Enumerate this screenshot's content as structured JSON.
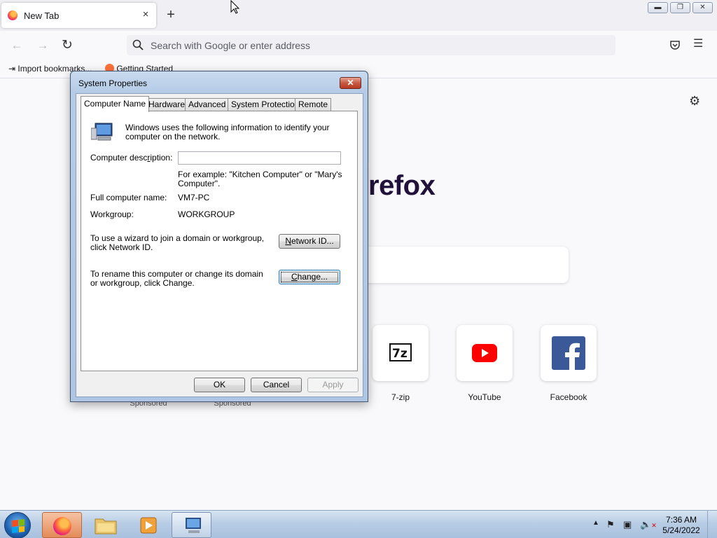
{
  "browser": {
    "tab_title": "New Tab",
    "tab_close": "×",
    "new_tab": "+",
    "url_placeholder": "Search with Google or enter address",
    "bookmarks": [
      {
        "label": "Import bookmarks..."
      },
      {
        "label": "Getting Started"
      }
    ]
  },
  "newtab": {
    "brand_text": "refox",
    "sponsored": [
      "Sponsored",
      "Sponsored"
    ],
    "shortcuts": [
      {
        "label": "7-zip",
        "icon": "7zip-icon"
      },
      {
        "label": "YouTube",
        "icon": "youtube-icon"
      },
      {
        "label": "Facebook",
        "icon": "facebook-icon"
      }
    ]
  },
  "dialog": {
    "title": "System Properties",
    "close": "✕",
    "tabs": [
      "Computer Name",
      "Hardware",
      "Advanced",
      "System Protection",
      "Remote"
    ],
    "intro": "Windows uses the following information to identify your computer on the network.",
    "description_label": "Computer description:",
    "description_value": "",
    "example": "For example: \"Kitchen Computer\" or \"Mary's Computer\".",
    "full_name_label": "Full computer name:",
    "full_name_value": "VM7-PC",
    "workgroup_label": "Workgroup:",
    "workgroup_value": "WORKGROUP",
    "network_text": "To use a wizard to join a domain or workgroup, click Network ID.",
    "network_button": "Network ID...",
    "rename_text": "To rename this computer or change its domain or workgroup, click Change.",
    "change_button": "Change...",
    "ok": "OK",
    "cancel": "Cancel",
    "apply": "Apply"
  },
  "taskbar": {
    "time": "7:36 AM",
    "date": "5/24/2022"
  },
  "colors": {
    "dialog_frame": "#b5cbe6",
    "firefox_brand": "#20123a",
    "youtube_red": "#ff0000",
    "facebook_blue": "#3b5998"
  }
}
